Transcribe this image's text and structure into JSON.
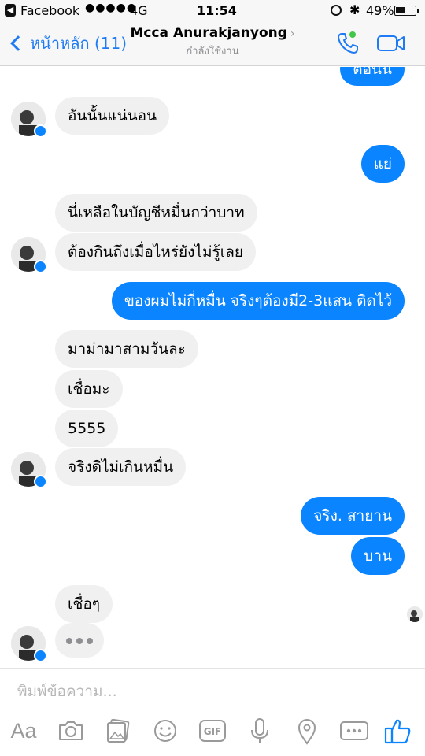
{
  "status_bar": {
    "back_glyph": "◀",
    "app_name": "Facebook",
    "signal": "●●●●●",
    "network": "4G",
    "time": "11:54",
    "battery": "49%",
    "battery_level": 0.49,
    "bluetooth": "✱"
  },
  "nav": {
    "back_label": "หน้าหลัก (11)",
    "contact_name": "Mcca Anurakjanyong",
    "title_chevron": "›",
    "status": "กำลังใช้งาน",
    "accent": "#1f7bf5",
    "online_color": "#44c64a"
  },
  "messages": [
    {
      "from": "me",
      "text": "ต่อนน"
    },
    {
      "from": "them",
      "text": "อันนั้นแน่นอน"
    },
    {
      "from": "me",
      "text": "แย่"
    },
    {
      "from": "them",
      "text": "นี่เหลือในบัญชีหมื่นกว่าบาท"
    },
    {
      "from": "them",
      "text": "ต้องกินถึงเมื่อไหร่ยังไม่รู้เลย"
    },
    {
      "from": "me",
      "text": "ของผมไม่กี่หมื่น จริงๆต้องมี2-3แสน ติดไว้"
    },
    {
      "from": "them",
      "text": "มาม่ามาสามวันละ"
    },
    {
      "from": "them",
      "text": "เชื่อมะ"
    },
    {
      "from": "them",
      "text": "5555"
    },
    {
      "from": "them",
      "text": "จริงดิไม่เกินหมื่น"
    },
    {
      "from": "me",
      "text": "จริง. สายาน"
    },
    {
      "from": "me",
      "text": "บาน"
    },
    {
      "from": "them",
      "text": "เชื่อๆ"
    }
  ],
  "composer": {
    "placeholder": "พิมพ์ข้อความ...",
    "aa_label": "Aa",
    "gif_label": "GIF",
    "tools": [
      "aa-icon",
      "camera-icon",
      "photo-gallery-icon",
      "emoji-icon",
      "gif-icon",
      "microphone-icon",
      "location-pin-icon",
      "more-icon",
      "thumbs-up-icon"
    ]
  },
  "colors": {
    "outgoing_bubble": "#0b84ff",
    "incoming_bubble": "#f0f0f0",
    "messenger_badge": "#0b84ff",
    "icon_gray": "#9a9a9a",
    "thumbs_up": "#0b84ff"
  }
}
